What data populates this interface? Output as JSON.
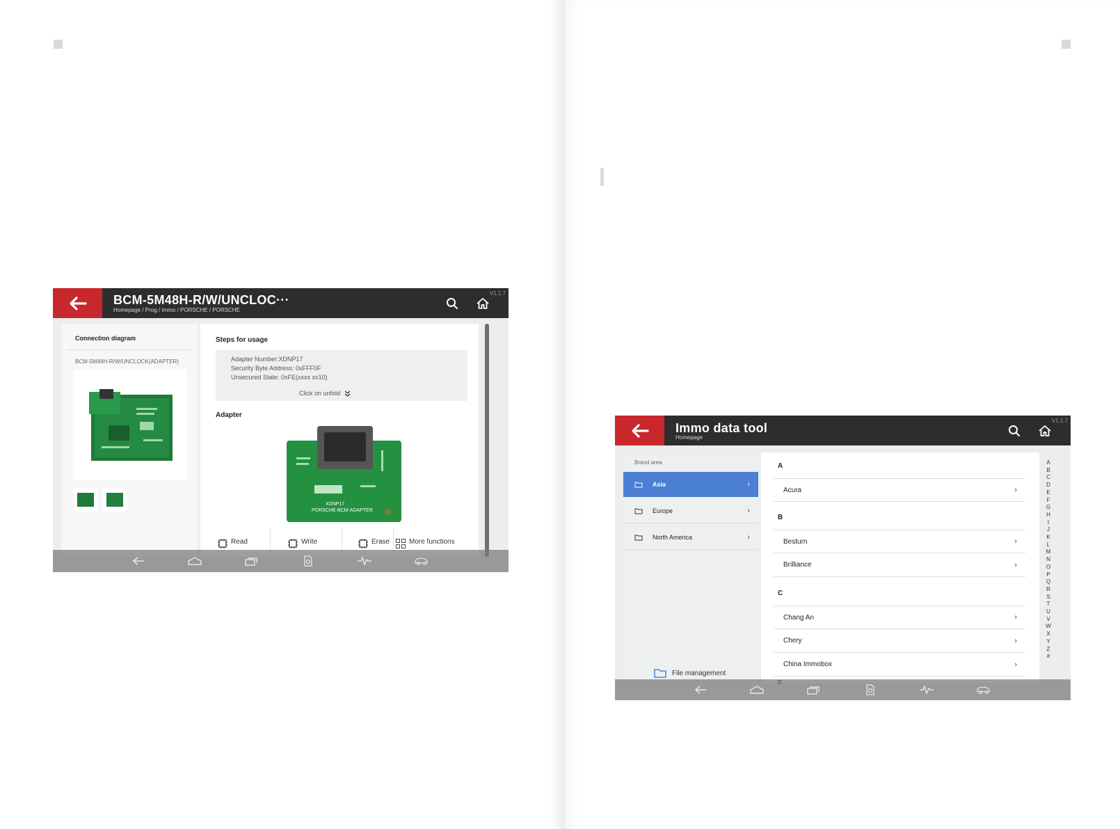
{
  "screen1": {
    "version": "V1.1.7",
    "title": "BCM-5M48H-R/W/UNCLOC···",
    "breadcrumb": "Homepage / Prog / Immo / PORSCHE / PORSCHE",
    "connection_title": "Connection diagram",
    "diagram_label": "BCM-5M48H-R/W/UNCLOCK(ADAPTER)",
    "steps_title": "Steps for usage",
    "steps_lines": [
      "Adapter Number:XDNP17",
      "Security Byte Address: 0xFFF0F",
      "Unsecured State: 0xFE(xxxx xx10)"
    ],
    "unfold": "Click on unfold",
    "adapter_title": "Adapter",
    "adapter_label_1": "XDNP17",
    "adapter_label_2": "PORSCHE-BCM-ADAPTER",
    "buttons": [
      "Read",
      "Write",
      "Erase",
      "More functions"
    ]
  },
  "screen2": {
    "version": "V1.1.7",
    "title": "Immo data tool",
    "breadcrumb": "Homepage",
    "brand_area": "Brand area",
    "regions": [
      "Asia",
      "Europe",
      "North America"
    ],
    "file_management": "File management",
    "letters": {
      "a": "A",
      "b": "B",
      "c": "C",
      "d": "D"
    },
    "brands": {
      "acura": "Acura",
      "besturn": "Besturn",
      "brilliance": "Brilliance",
      "chang_an": "Chang An",
      "chery": "Chery",
      "china_immobox": "China Immobox"
    },
    "alphabet": [
      "A",
      "B",
      "C",
      "D",
      "E",
      "F",
      "G",
      "H",
      "I",
      "J",
      "K",
      "L",
      "M",
      "N",
      "O",
      "P",
      "Q",
      "R",
      "S",
      "T",
      "U",
      "V",
      "W",
      "X",
      "Y",
      "Z",
      "#"
    ]
  },
  "colors": {
    "accent_red": "#c8282c",
    "topbar": "#2d2d2d",
    "selected_blue": "#4a7fd4"
  },
  "icons": [
    "back-arrow-icon",
    "search-icon",
    "home-icon",
    "chevron-right-icon",
    "folder-icon",
    "chip-icon",
    "grid-icon"
  ]
}
